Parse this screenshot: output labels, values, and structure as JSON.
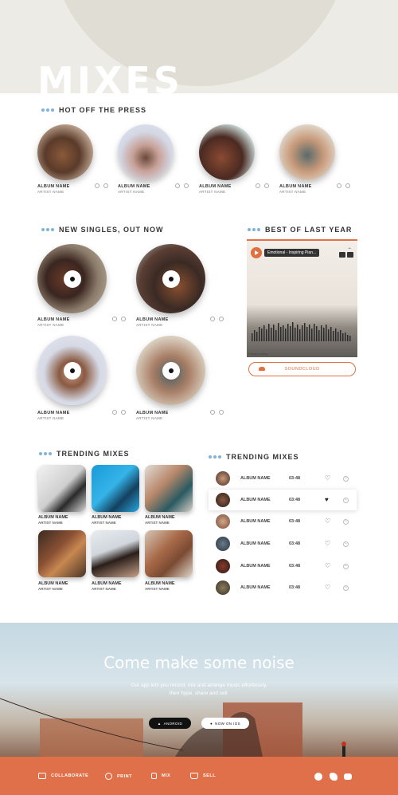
{
  "hero": {
    "title": "MIXES"
  },
  "hot": {
    "title": "HOT OFF THE PRESS",
    "items": [
      {
        "album": "ALBUM NAME",
        "artist": "ARTIST NAME"
      },
      {
        "album": "ALBUM NAME",
        "artist": "ARTIST NAME"
      },
      {
        "album": "ALBUM NAME",
        "artist": "ARTIST NAME"
      },
      {
        "album": "ALBUM NAME",
        "artist": "ARTIST NAME"
      }
    ]
  },
  "singles": {
    "title": "NEW SINGLES, OUT NOW",
    "items": [
      {
        "album": "ALBUM NAME",
        "artist": "ARTIST NAME"
      },
      {
        "album": "ALBUM NAME",
        "artist": "ARTIST NAME"
      },
      {
        "album": "ALBUM NAME",
        "artist": "ARTIST NAME"
      },
      {
        "album": "ALBUM NAME",
        "artist": "ARTIST NAME"
      }
    ]
  },
  "best": {
    "title": "BEST OF LAST YEAR",
    "track": "Emotional - Inspiring Pian...",
    "policy": "Privacy policy",
    "button": "SOUNDCLOUD"
  },
  "trending_mixes": {
    "title": "TRENDING MIXES",
    "items": [
      {
        "album": "ALBUM NAME",
        "artist": "ARTIST NAME"
      },
      {
        "album": "ALBUM NAME",
        "artist": "ARTIST NAME"
      },
      {
        "album": "ALBUM NAME",
        "artist": "ARTIST NAME"
      },
      {
        "album": "ALBUM NAME",
        "artist": "ARTIST NAME"
      },
      {
        "album": "ALBUM NAME",
        "artist": "ARTIST NAME"
      },
      {
        "album": "ALBUM NAME",
        "artist": "ARTIST NAME"
      }
    ]
  },
  "trending_list": {
    "title": "TRENDING MIXES",
    "rows": [
      {
        "album": "ALBUM NAME",
        "time": "03:48",
        "liked": false
      },
      {
        "album": "ALBUM NAME",
        "time": "03:48",
        "liked": true
      },
      {
        "album": "ALBUM NAME",
        "time": "03:48",
        "liked": false
      },
      {
        "album": "ALBUM NAME",
        "time": "03:48",
        "liked": false
      },
      {
        "album": "ALBUM NAME",
        "time": "03:48",
        "liked": false
      },
      {
        "album": "ALBUM NAME",
        "time": "03:48",
        "liked": false
      }
    ]
  },
  "banner": {
    "title": "Come make some noise",
    "subtitle": "Our app lets you record, mix and arrange music effortlessly, then hype, share and sell.",
    "android": "ANDROID",
    "ios": "NOW ON IOS"
  },
  "footer": {
    "items": [
      "COLLABORATE",
      "PRINT",
      "MIX",
      "SELL"
    ]
  },
  "colors": {
    "accent": "#e0704a",
    "dots": "#7fb3d8"
  }
}
